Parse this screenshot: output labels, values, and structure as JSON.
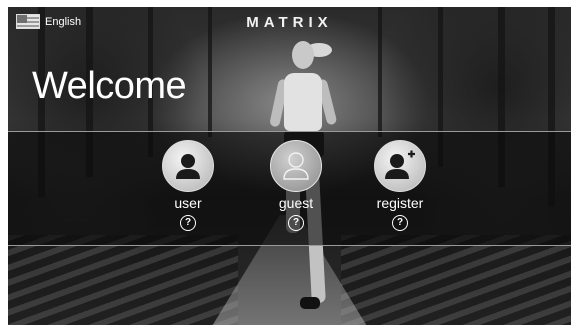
{
  "header": {
    "language_label": "English",
    "language_icon": "us-flag-icon",
    "brand": "MATRIX"
  },
  "welcome_title": "Welcome",
  "login_options": [
    {
      "label": "user",
      "icon": "user-icon",
      "help": "?"
    },
    {
      "label": "guest",
      "icon": "guest-user-icon",
      "help": "?"
    },
    {
      "label": "register",
      "icon": "add-user-icon",
      "help": "?"
    }
  ],
  "colors": {
    "band_overlay": "#0c0c0c",
    "icon_circle": "#c9c9c9",
    "icon_glyph": "#1a1a1a",
    "text": "#ffffff"
  }
}
